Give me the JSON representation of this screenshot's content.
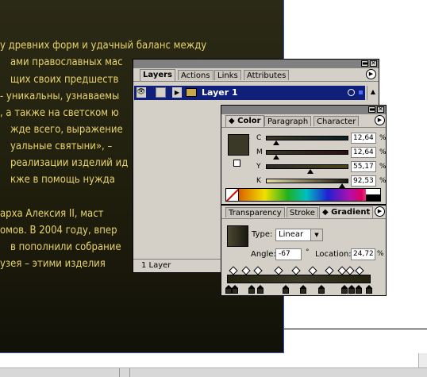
{
  "document": {
    "lines": [
      "у древних форм и удачный баланс между",
      "ами православных мас",
      "щих своих предшеств",
      "- уникальны, узнаваемы",
      ", а также на светском ю",
      "жде всего, выражение",
      "уальные святыни», –",
      "реализации изделий ид",
      "кже в помощь нужда",
      "",
      "арха Алексия II, маст",
      "омов. В 2004 году, впер",
      "в пополнили собрание",
      "узея – этими изделия"
    ]
  },
  "layers_palette": {
    "tabs": [
      "Layers",
      "Actions",
      "Links",
      "Attributes"
    ],
    "active_tab": "Layers",
    "layer_name": "Layer 1",
    "layer_color": "#c9a64a",
    "footer": "1 Layer"
  },
  "color_palette": {
    "tabs": [
      "Color",
      "Paragraph",
      "Character"
    ],
    "active_tab": "Color",
    "fill_color": "#3a3826",
    "channels": [
      {
        "label": "C",
        "value": "12,64",
        "level": 0.1264
      },
      {
        "label": "M",
        "value": "12,64",
        "level": 0.1264
      },
      {
        "label": "Y",
        "value": "55,17",
        "level": 0.5517
      },
      {
        "label": "K",
        "value": "92,53",
        "level": 0.9253
      }
    ],
    "unit": "%"
  },
  "gradient_palette": {
    "tabs": [
      "Transparency",
      "Stroke",
      "Gradient"
    ],
    "active_tab": "Gradient",
    "type_label": "Type:",
    "type_value": "Linear",
    "angle_label": "Angle:",
    "angle_value": "-67",
    "angle_unit": "°",
    "location_label": "Location:",
    "location_value": "24,72",
    "location_unit": "%"
  }
}
